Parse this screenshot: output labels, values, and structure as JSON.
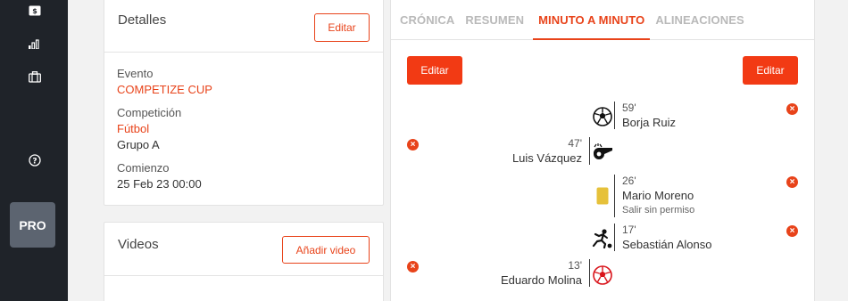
{
  "sidebar": {
    "icons": [
      "billing-icon",
      "stats-icon",
      "briefcase-icon",
      "help-icon"
    ],
    "pro_label": "PRO"
  },
  "details": {
    "title": "Detalles",
    "edit_label": "Editar",
    "event_label": "Evento",
    "event_value": "COMPETIZE CUP",
    "competition_label": "Competición",
    "competition_value": "Fútbol",
    "group_value": "Grupo A",
    "start_label": "Comienzo",
    "start_value": "25 Feb 23 00:00"
  },
  "videos": {
    "title": "Videos",
    "add_label": "Añadir video"
  },
  "tabs": [
    {
      "label": "CRÓNICA",
      "active": false
    },
    {
      "label": "RESUMEN",
      "active": false
    },
    {
      "label": "MINUTO A MINUTO",
      "active": true
    },
    {
      "label": "ALINEACIONES",
      "active": false
    }
  ],
  "timeline": {
    "edit_left": "Editar",
    "edit_right": "Editar",
    "events": [
      {
        "minute": "59'",
        "player": "Borja Ruiz",
        "side": "right",
        "icon": "goal-ball-icon"
      },
      {
        "minute": "47'",
        "player": "Luis Vázquez",
        "side": "left",
        "icon": "whistle-icon"
      },
      {
        "minute": "26'",
        "player": "Mario Moreno",
        "note": "Salir sin permiso",
        "side": "right",
        "icon": "yellow-card-icon"
      },
      {
        "minute": "17'",
        "player": "Sebastián Alonso",
        "side": "right",
        "icon": "player-kick-icon"
      },
      {
        "minute": "13'",
        "player": "Eduardo Molina",
        "side": "left",
        "icon": "own-goal-ball-icon"
      }
    ]
  },
  "colors": {
    "accent": "#e8431a",
    "button_fill": "#f23a14",
    "sidebar": "#1f2329",
    "yellow_card": "#e6c13a"
  }
}
